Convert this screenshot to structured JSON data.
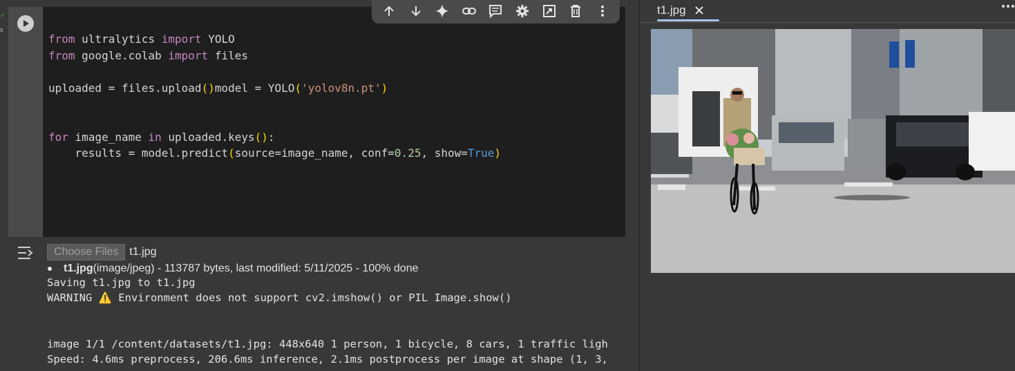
{
  "gutter": {
    "status_mark": "✓",
    "label": "s"
  },
  "code_cell": {
    "lines": {
      "l1": {
        "kw1": "from",
        "mod": " ultralytics ",
        "kw2": "import",
        "name": " YOLO"
      },
      "l2": {
        "kw1": "from",
        "mod": " google.colab ",
        "kw2": "import",
        "name": " files"
      },
      "l4": {
        "lhs": "uploaded = files.upload",
        "open": "(",
        "close": ")"
      },
      "l7": {
        "lhs": "model = YOLO",
        "open": "(",
        "str": "'yolov8n.pt'",
        "close": ")"
      },
      "l10": {
        "kw1": "for",
        "var": " image_name ",
        "kw2": "in",
        "mid": " uploaded.keys",
        "open": "()",
        "tail": ":"
      },
      "l11": {
        "pre": "    results = model.predict",
        "open": "(",
        "args": "source=image_name, conf=",
        "num": "0.25",
        "comma": ", show=",
        "bool": "True",
        "close": ")"
      }
    }
  },
  "toolbar": {
    "icons": [
      "arrow-up-icon",
      "arrow-down-icon",
      "sparkle-icon",
      "link-icon",
      "comment-icon",
      "gear-icon",
      "open-in-tab-icon",
      "trash-icon",
      "more-vert-icon"
    ]
  },
  "output": {
    "choose_button": "Choose Files",
    "chosen_file": "t1.jpg",
    "file_entry": {
      "name": "t1.jpg",
      "detail": "(image/jpeg) - 113787 bytes, last modified: 5/11/2025 - 100% done"
    },
    "saving_line": "Saving t1.jpg to t1.jpg",
    "warning_prefix": "WARNING ",
    "warning_icon": "⚠️",
    "warning_text": " Environment does not support cv2.imshow() or PIL Image.show()",
    "image_line": "image 1/1 /content/datasets/t1.jpg: 448x640 1 person, 1 bicycle, 8 cars, 1 traffic ligh",
    "speed_line": "Speed: 4.6ms preprocess, 206.6ms inference, 2.1ms postprocess per image at shape (1, 3,"
  },
  "viewer": {
    "tab_title": "t1.jpg",
    "more_label": "•••"
  },
  "colors": {
    "background": "#383838",
    "editor": "#1e1e1e",
    "keyword": "#c586c0",
    "bracket": "#ffd700",
    "string": "#ce9178",
    "number": "#b5cea8",
    "boolean": "#569cd6",
    "tab_accent": "#a8c7fa"
  }
}
